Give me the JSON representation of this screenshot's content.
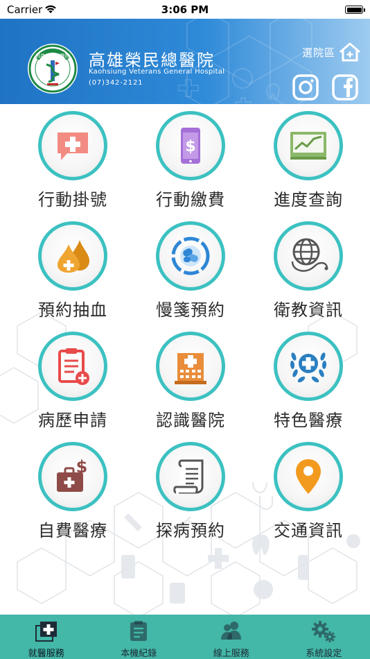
{
  "status_bar": {
    "carrier": "Carrier",
    "time": "3:06 PM"
  },
  "header": {
    "name_zh": "高雄榮民總醫院",
    "name_en": "Kaohsiung Veterans General Hospital",
    "phone": "(07)342-2121",
    "logo_text": "高雄榮民總醫院",
    "select_branch": "選院區",
    "colors": {
      "gradient_start": "#1f73c4",
      "gradient_end": "#9ecbf0"
    }
  },
  "menu": [
    {
      "label": "行動掛號",
      "icon": "medical-chat-icon"
    },
    {
      "label": "行動繳費",
      "icon": "phone-payment-icon"
    },
    {
      "label": "進度查詢",
      "icon": "progress-chart-icon"
    },
    {
      "label": "預約抽血",
      "icon": "blood-drops-icon"
    },
    {
      "label": "慢箋預約",
      "icon": "pills-icon"
    },
    {
      "label": "衛教資訊",
      "icon": "globe-stethoscope-icon"
    },
    {
      "label": "病歷申請",
      "icon": "clipboard-icon"
    },
    {
      "label": "認識醫院",
      "icon": "hospital-building-icon"
    },
    {
      "label": "特色醫療",
      "icon": "laurel-cross-icon"
    },
    {
      "label": "自費醫療",
      "icon": "medical-bag-dollar-icon"
    },
    {
      "label": "探病預約",
      "icon": "document-scroll-icon"
    },
    {
      "label": "交通資訊",
      "icon": "map-pin-icon"
    }
  ],
  "tabs": [
    {
      "label": "就醫服務",
      "icon": "medical-service-icon",
      "active": true
    },
    {
      "label": "本機紀錄",
      "icon": "record-icon",
      "active": false
    },
    {
      "label": "線上服務",
      "icon": "online-users-icon",
      "active": false
    },
    {
      "label": "系統設定",
      "icon": "settings-gears-icon",
      "active": false
    }
  ],
  "colors": {
    "ring": "#3cc1c1",
    "tab_bar": "#43b7a8",
    "label_text": "#2b2b2b"
  }
}
